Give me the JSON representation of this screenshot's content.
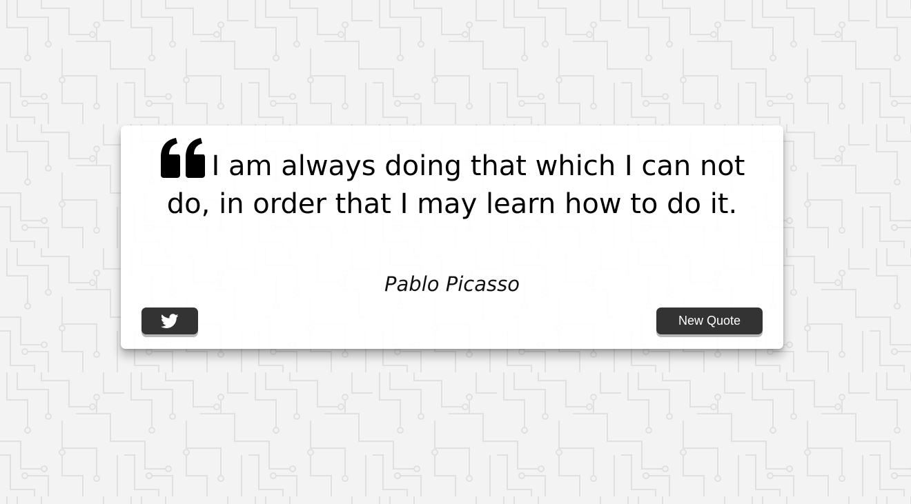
{
  "quote": {
    "text": "I am always doing that which I can not do, in order that I may learn how to do it.",
    "author": "Pablo Picasso",
    "icon": "quote-left-icon"
  },
  "actions": {
    "tweet": {
      "icon": "twitter-icon"
    },
    "new_quote_label": "New Quote"
  },
  "colors": {
    "button_bg": "#333333",
    "button_text": "#ffffff",
    "card_bg": "#ffffff",
    "pattern_line": "#e2e2e2",
    "page_bg": "#f3f3f3"
  }
}
